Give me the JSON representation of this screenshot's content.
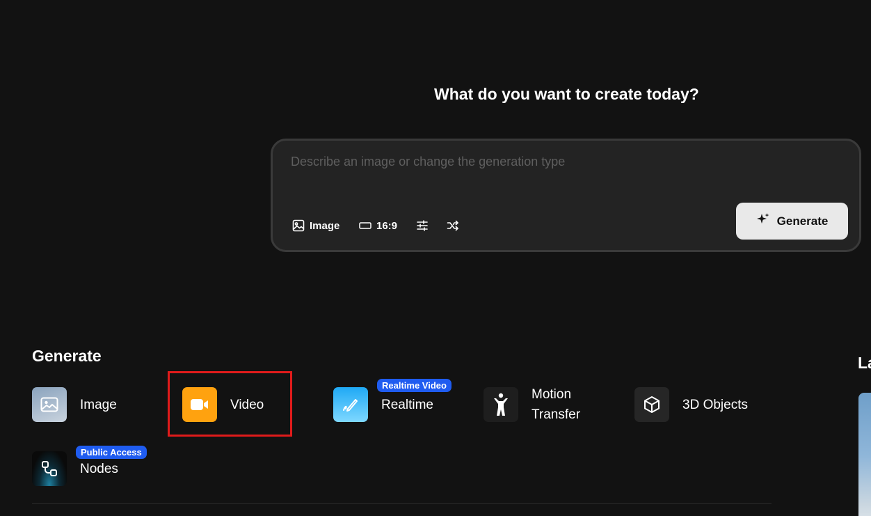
{
  "hero": {
    "title": "What do you want to create today?"
  },
  "prompt": {
    "placeholder": "Describe an image or change the generation type",
    "value": "",
    "toolbar": {
      "type_label": "Image",
      "aspect_label": "16:9"
    },
    "generate_label": "Generate"
  },
  "generate_section": {
    "title": "Generate",
    "items": [
      {
        "label": "Image",
        "icon": "image-icon"
      },
      {
        "label": "Video",
        "icon": "video-camera-icon",
        "color": "#ffa20f"
      },
      {
        "label": "Realtime",
        "icon": "pen-icon",
        "badge": "Realtime Video"
      },
      {
        "label_line1": "Motion",
        "label_line2": "Transfer",
        "icon": "person-icon"
      },
      {
        "label": "3D Objects",
        "icon": "cube-icon"
      },
      {
        "label": "Nodes",
        "icon": "nodes-icon",
        "badge": "Public Access"
      }
    ]
  },
  "right_section": {
    "title_partial": "La"
  },
  "colors": {
    "background": "#121212",
    "badge": "#1f5cf0",
    "highlight": "#e01b1b",
    "generate_button": "#e9e9e9"
  }
}
